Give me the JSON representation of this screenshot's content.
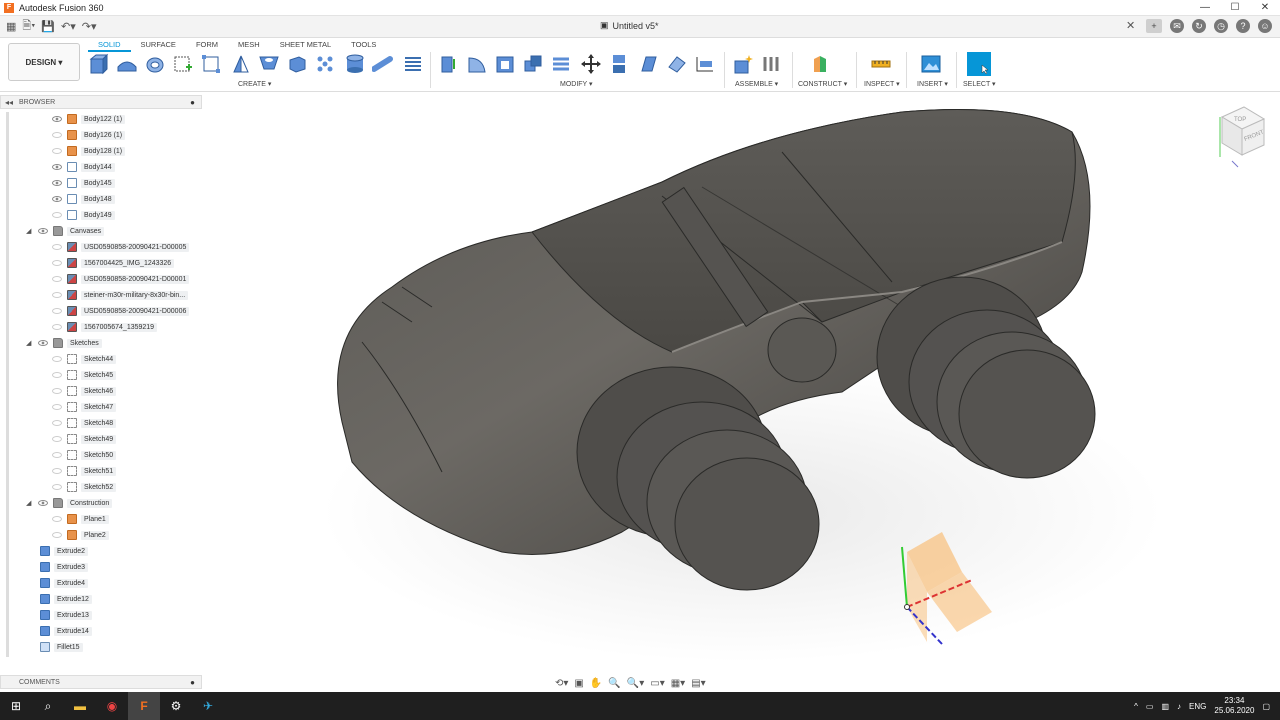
{
  "window": {
    "app_title": "Autodesk Fusion 360",
    "app_icon_letter": "F",
    "minimize": "—",
    "maximize": "☐",
    "close": "✕"
  },
  "document": {
    "title": "Untitled v5*",
    "close": "✕"
  },
  "workspace": {
    "label": "DESIGN ▾"
  },
  "ribbon_tabs": [
    "SOLID",
    "SURFACE",
    "FORM",
    "MESH",
    "SHEET METAL",
    "TOOLS"
  ],
  "groups": {
    "create": "CREATE ▾",
    "modify": "MODIFY ▾",
    "assemble": "ASSEMBLE ▾",
    "construct": "CONSTRUCT ▾",
    "inspect": "INSPECT ▾",
    "insert": "INSERT ▾",
    "select": "SELECT ▾"
  },
  "browser": {
    "title": "BROWSER",
    "items": [
      {
        "label": "Body122 (1)",
        "icon": "component-icon"
      },
      {
        "label": "Body126 (1)",
        "icon": "component-icon"
      },
      {
        "label": "Body128 (1)",
        "icon": "component-icon"
      },
      {
        "label": "Body144",
        "icon": "body-icon"
      },
      {
        "label": "Body145",
        "icon": "body-icon"
      },
      {
        "label": "Body148",
        "icon": "body-icon"
      },
      {
        "label": "Body149",
        "icon": "body-icon"
      },
      {
        "label": "Canvases",
        "icon": "folder-icon"
      },
      {
        "label": "USD0590858-20090421-D00005",
        "icon": "canvas-icon"
      },
      {
        "label": "1567004425_IMG_1243326",
        "icon": "canvas-icon"
      },
      {
        "label": "USD0590858-20090421-D00001",
        "icon": "canvas-icon"
      },
      {
        "label": "steiner-m30r-military-8x30r-bin...",
        "icon": "canvas-icon"
      },
      {
        "label": "USD0590858-20090421-D00006",
        "icon": "canvas-icon"
      },
      {
        "label": "1567005674_1359219",
        "icon": "canvas-icon"
      },
      {
        "label": "Sketches",
        "icon": "folder-icon"
      },
      {
        "label": "Sketch44",
        "icon": "sketch-icon"
      },
      {
        "label": "Sketch45",
        "icon": "sketch-icon"
      },
      {
        "label": "Sketch46",
        "icon": "sketch-icon"
      },
      {
        "label": "Sketch47",
        "icon": "sketch-icon"
      },
      {
        "label": "Sketch48",
        "icon": "sketch-icon"
      },
      {
        "label": "Sketch49",
        "icon": "sketch-icon"
      },
      {
        "label": "Sketch50",
        "icon": "sketch-icon"
      },
      {
        "label": "Sketch51",
        "icon": "sketch-icon"
      },
      {
        "label": "Sketch52",
        "icon": "sketch-icon"
      },
      {
        "label": "Construction",
        "icon": "folder-icon"
      },
      {
        "label": "Plane1",
        "icon": "plane-icon"
      },
      {
        "label": "Plane2",
        "icon": "plane-icon"
      },
      {
        "label": "Extrude2",
        "icon": "extrude-icon"
      },
      {
        "label": "Extrude3",
        "icon": "extrude-icon"
      },
      {
        "label": "Extrude4",
        "icon": "extrude-icon"
      },
      {
        "label": "Extrude12",
        "icon": "extrude-icon"
      },
      {
        "label": "Extrude13",
        "icon": "extrude-icon"
      },
      {
        "label": "Extrude14",
        "icon": "extrude-icon"
      },
      {
        "label": "Fillet15",
        "icon": "fillet-icon"
      }
    ]
  },
  "comments": {
    "title": "COMMENTS"
  },
  "viewcube": {
    "top": "TOP",
    "front": "FRONT"
  },
  "taskbar": {
    "lang": "ENG",
    "time": "23:34",
    "date": "25.06.2020"
  },
  "colors": {
    "accent": "#0696d7",
    "model": "#4a4844",
    "taskbar": "#1f1f1f"
  }
}
